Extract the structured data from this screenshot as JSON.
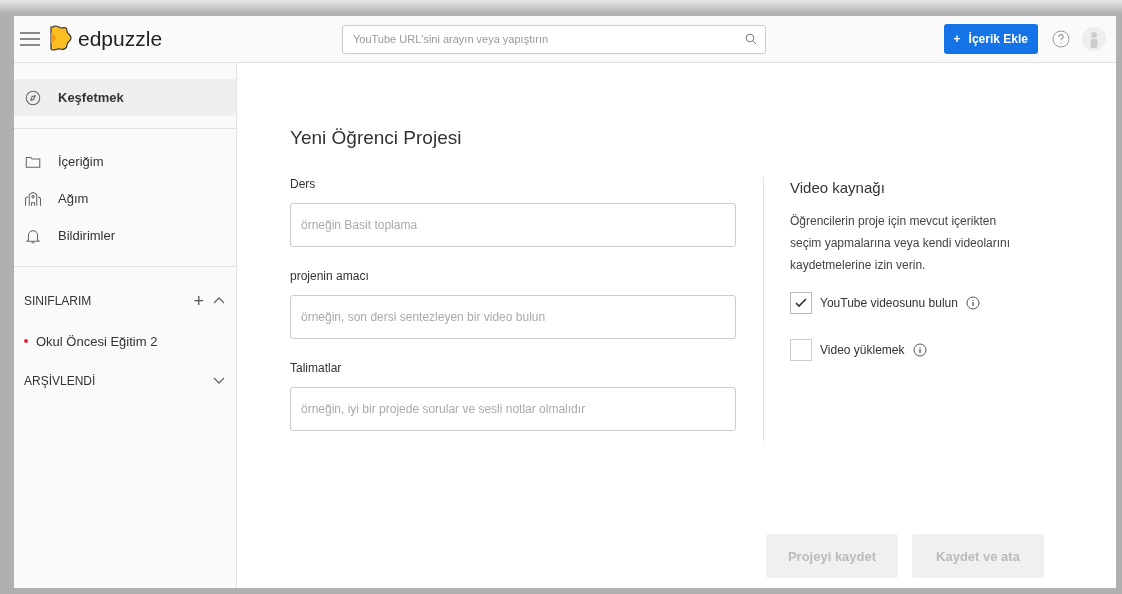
{
  "header": {
    "logo": "edpuzzle",
    "search": {
      "placeholder": "YouTube URL'sini arayın veya yapıştırın"
    },
    "add_button": "+",
    "add_label": "İçerik Ekle"
  },
  "sidebar": {
    "items": [
      {
        "label": "Keşfetmek",
        "selected": true
      }
    ],
    "nav": [
      {
        "label": "İçeriğim",
        "selected": false
      },
      {
        "label": "Ağım",
        "selected": false
      },
      {
        "label": "Bildirimler",
        "selected": false
      }
    ],
    "classes": {
      "title": "SINIFLARIM",
      "add": "+",
      "expanded": true,
      "items": [
        {
          "label": "Okul Öncesi Eğitim 2",
          "color": "#e0283a"
        }
      ]
    },
    "archived": {
      "title": "ARŞİVLENDİ",
      "expanded": false
    }
  },
  "form": {
    "title": "Yeni Öğrenci Projesi",
    "fields": [
      {
        "label": "Ders",
        "placeholder": "örneğin Basit toplama"
      },
      {
        "label": "projenin amacı",
        "placeholder": "örneğin, son dersi sentezleyen bir video bulun"
      },
      {
        "label": "Talimatlar",
        "placeholder": "örneğin, iyi bir projede sorular ve sesli notlar olmalıdır"
      }
    ]
  },
  "video_source": {
    "title": "Video kaynağı",
    "description": "Öğrencilerin proje için mevcut içerikten seçim yapmalarına veya kendi videolarını kaydetmelerine izin verin.",
    "options": [
      {
        "label": "YouTube videosunu bulun",
        "checked": true
      },
      {
        "label": "Video yüklemek",
        "checked": false
      }
    ]
  },
  "buttons": [
    {
      "label": "Projeyi kaydet",
      "disabled": true
    },
    {
      "label": "Kaydet ve ata",
      "disabled": true
    }
  ]
}
